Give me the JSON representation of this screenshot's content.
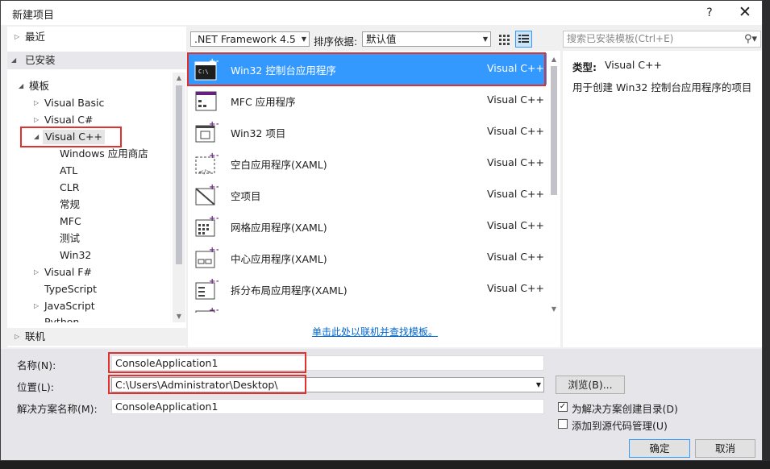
{
  "title": "新建项目",
  "title_controls": {
    "help": "?",
    "close": "✕"
  },
  "tree": {
    "recent": "最近",
    "installed": "已安装",
    "templates": "模板",
    "items": [
      "Visual Basic",
      "Visual C#",
      "Visual C++"
    ],
    "cpp_children": [
      "Windows 应用商店",
      "ATL",
      "CLR",
      "常规",
      "MFC",
      "测试",
      "Win32"
    ],
    "after": [
      "Visual F#",
      "TypeScript",
      "JavaScript",
      "Python"
    ],
    "online": "联机"
  },
  "toolbar": {
    "framework": ".NET Framework 4.5",
    "sort_label": "排序依据:",
    "sort_value": "默认值"
  },
  "search": {
    "placeholder": "搜索已安装模板(Ctrl+E)",
    "icon": "search-icon"
  },
  "templates": [
    {
      "name": "Win32 控制台应用程序",
      "lang": "Visual C++",
      "icon": "console-app-icon",
      "selected": true
    },
    {
      "name": "MFC 应用程序",
      "lang": "Visual C++",
      "icon": "mfc-app-icon"
    },
    {
      "name": "Win32 项目",
      "lang": "Visual C++",
      "icon": "win32-project-icon"
    },
    {
      "name": "空白应用程序(XAML)",
      "lang": "Visual C++",
      "icon": "blank-app-icon"
    },
    {
      "name": "空项目",
      "lang": "Visual C++",
      "icon": "empty-project-icon"
    },
    {
      "name": "网格应用程序(XAML)",
      "lang": "Visual C++",
      "icon": "grid-app-icon"
    },
    {
      "name": "中心应用程序(XAML)",
      "lang": "Visual C++",
      "icon": "hub-app-icon"
    },
    {
      "name": "拆分布局应用程序(XAML)",
      "lang": "Visual C++",
      "icon": "split-app-icon"
    }
  ],
  "online_link": "单击此处以联机并查找模板。",
  "details": {
    "type_label": "类型:",
    "type_value": "Visual C++",
    "description": "用于创建 Win32 控制台应用程序的项目"
  },
  "form": {
    "name_label": "名称(N):",
    "name_value": "ConsoleApplication1",
    "location_label": "位置(L):",
    "location_value": "C:\\Users\\Administrator\\Desktop\\",
    "solution_label": "解决方案名称(M):",
    "solution_value": "ConsoleApplication1",
    "browse": "浏览(B)...",
    "create_dir": "为解决方案创建目录(D)",
    "create_dir_checked": true,
    "add_source_control": "添加到源代码管理(U)",
    "add_source_control_checked": false,
    "ok": "确定",
    "cancel": "取消"
  },
  "colors": {
    "selection": "#3399ff",
    "highlight_box": "#e0312e",
    "link": "#0066cc"
  }
}
